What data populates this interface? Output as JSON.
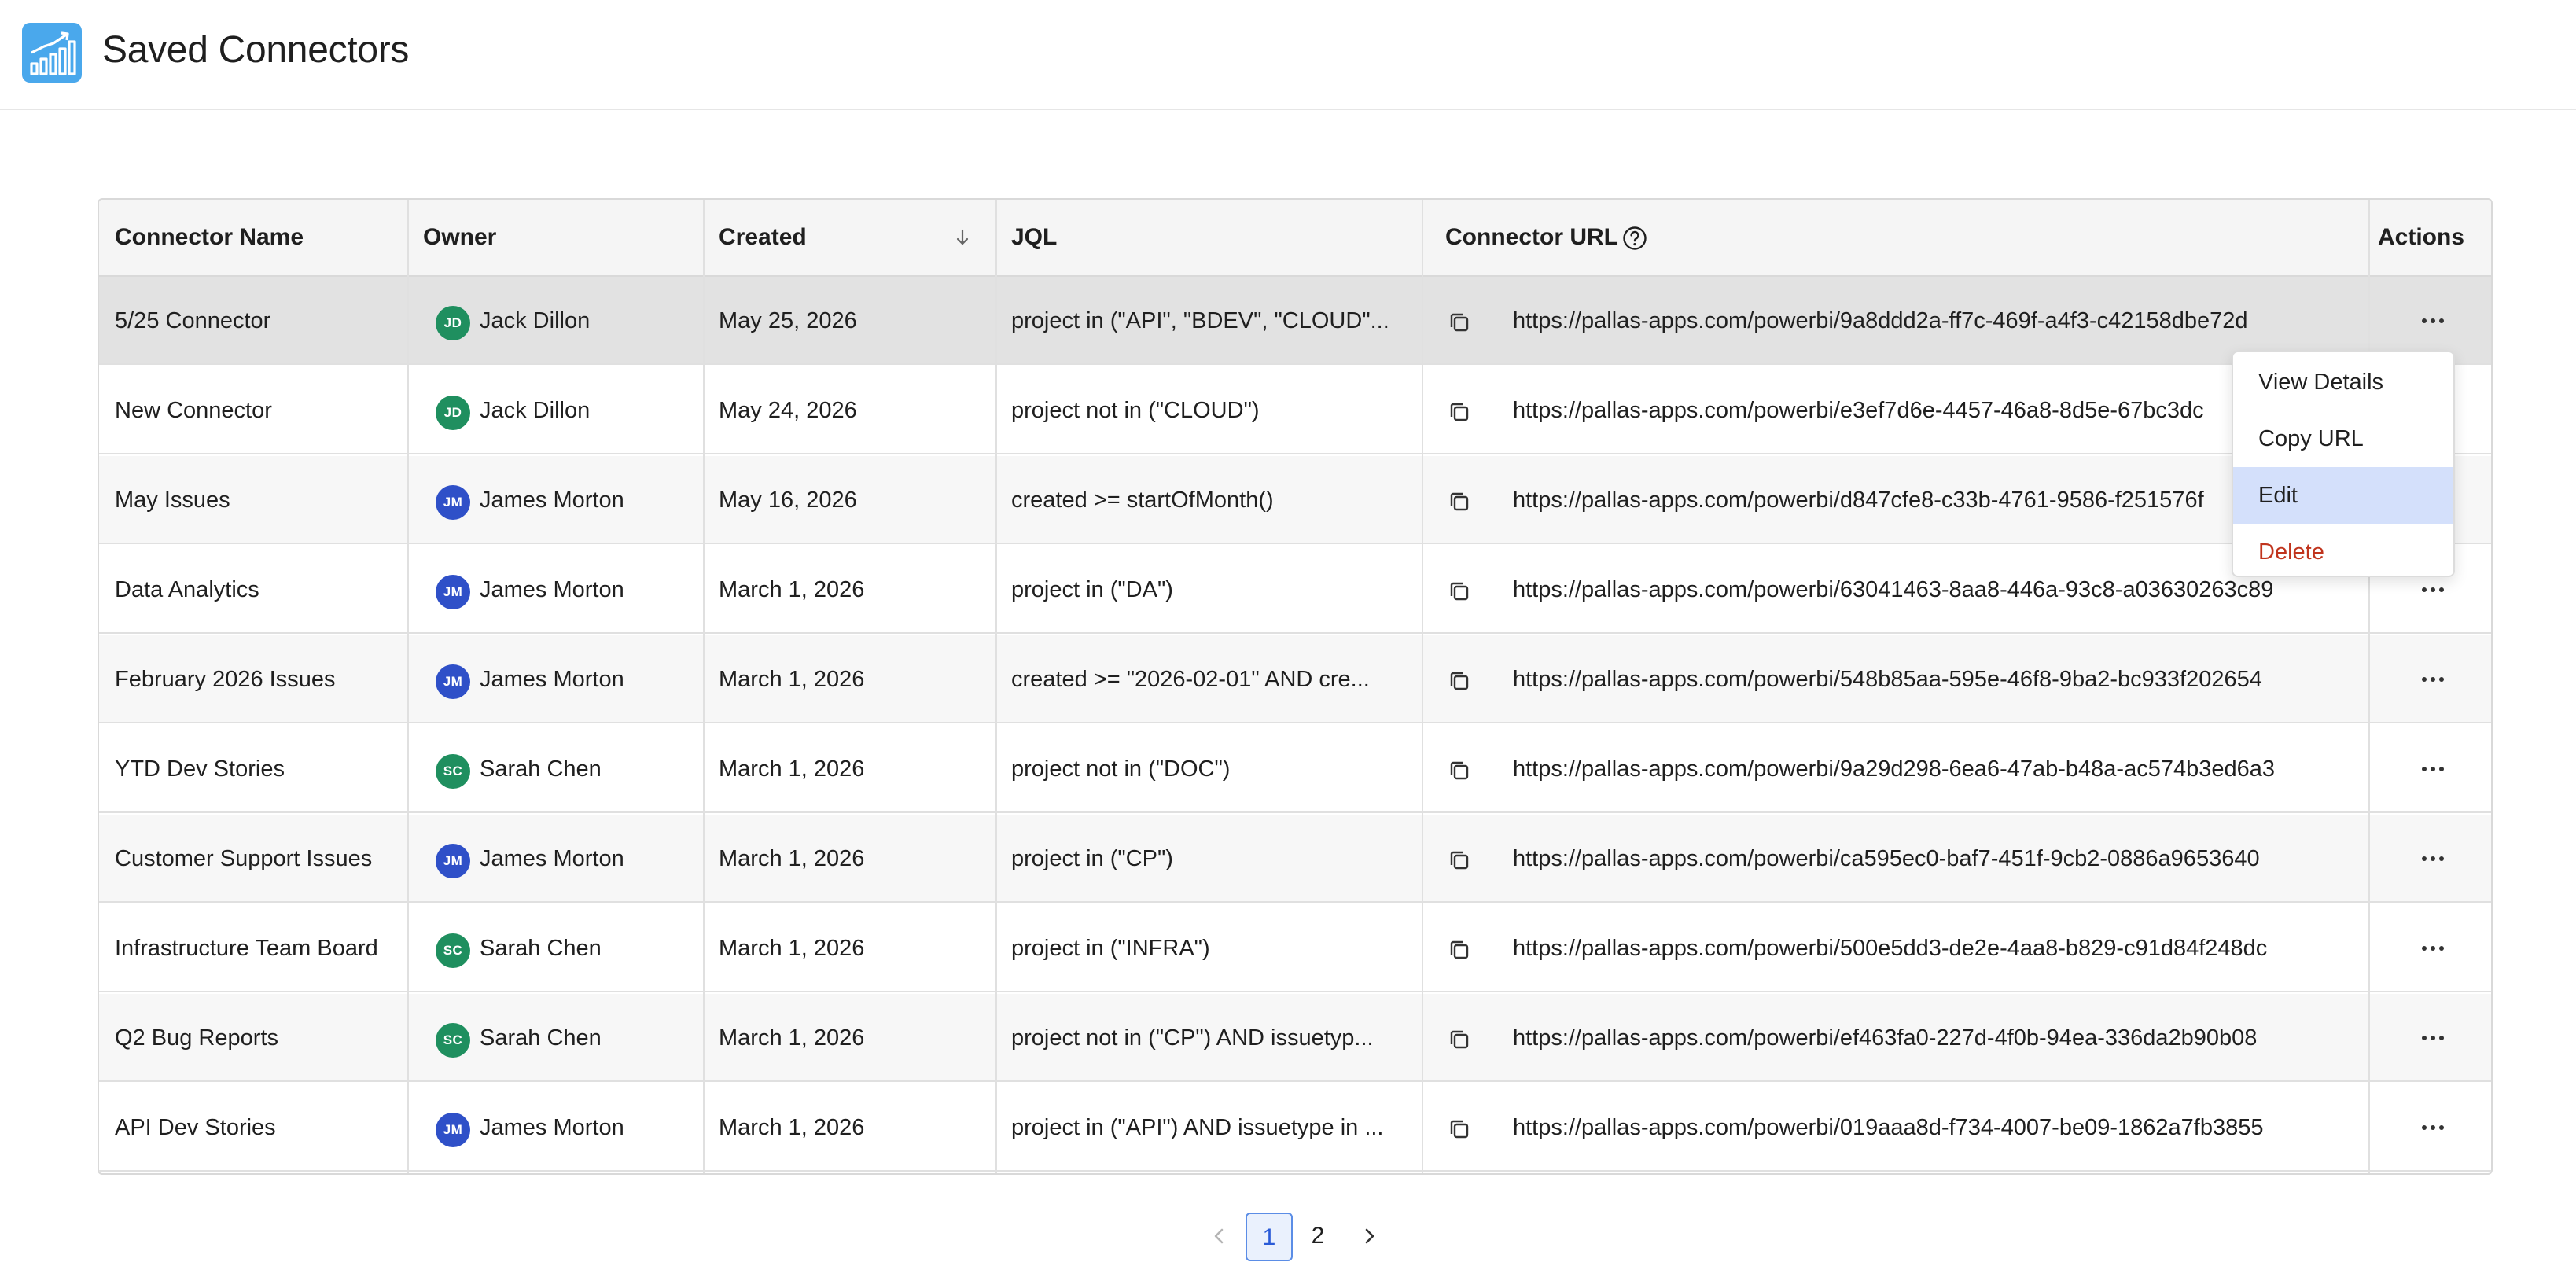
{
  "header": {
    "title": "Saved Connectors",
    "logo_icon": "chart-growth-icon"
  },
  "table": {
    "columns": {
      "name": "Connector Name",
      "owner": "Owner",
      "created": "Created",
      "jql": "JQL",
      "url": "Connector URL",
      "actions": "Actions"
    },
    "sort": {
      "column": "Created",
      "direction": "descending"
    },
    "rows": [
      {
        "name": "5/25 Connector",
        "owner_initials": "JD",
        "owner": "Jack Dillon",
        "owner_color": "#1f8f5f",
        "created": "May 25, 2026",
        "jql": "project in (\"API\", \"BDEV\", \"CLOUD\"...",
        "url": "https://pallas-apps.com/powerbi/9a8ddd2a-ff7c-469f-a4f3-c42158dbe72d"
      },
      {
        "name": "New Connector",
        "owner_initials": "JD",
        "owner": "Jack Dillon",
        "owner_color": "#1f8f5f",
        "created": "May 24, 2026",
        "jql": "project not in (\"CLOUD\")",
        "url": "https://pallas-apps.com/powerbi/e3ef7d6e-4457-46a8-8d5e-67bc3dc"
      },
      {
        "name": "May Issues",
        "owner_initials": "JM",
        "owner": "James Morton",
        "owner_color": "#2f50c8",
        "created": "May 16, 2026",
        "jql": "created >= startOfMonth()",
        "url": "https://pallas-apps.com/powerbi/d847cfe8-c33b-4761-9586-f251576f"
      },
      {
        "name": "Data Analytics",
        "owner_initials": "JM",
        "owner": "James Morton",
        "owner_color": "#2f50c8",
        "created": "March 1, 2026",
        "jql": "project in (\"DA\")",
        "url": "https://pallas-apps.com/powerbi/63041463-8aa8-446a-93c8-a03630263c89"
      },
      {
        "name": "February 2026 Issues",
        "owner_initials": "JM",
        "owner": "James Morton",
        "owner_color": "#2f50c8",
        "created": "March 1, 2026",
        "jql": "created >= \"2026-02-01\" AND cre...",
        "url": "https://pallas-apps.com/powerbi/548b85aa-595e-46f8-9ba2-bc933f202654"
      },
      {
        "name": "YTD Dev Stories",
        "owner_initials": "SC",
        "owner": "Sarah Chen",
        "owner_color": "#1f8f5f",
        "created": "March 1, 2026",
        "jql": "project not in (\"DOC\")",
        "url": "https://pallas-apps.com/powerbi/9a29d298-6ea6-47ab-b48a-ac574b3ed6a3"
      },
      {
        "name": "Customer Support Issues",
        "owner_initials": "JM",
        "owner": "James Morton",
        "owner_color": "#2f50c8",
        "created": "March 1, 2026",
        "jql": "project in (\"CP\")",
        "url": "https://pallas-apps.com/powerbi/ca595ec0-baf7-451f-9cb2-0886a9653640"
      },
      {
        "name": "Infrastructure Team Board",
        "owner_initials": "SC",
        "owner": "Sarah Chen",
        "owner_color": "#1f8f5f",
        "created": "March 1, 2026",
        "jql": "project in (\"INFRA\")",
        "url": "https://pallas-apps.com/powerbi/500e5dd3-de2e-4aa8-b829-c91d84f248dc"
      },
      {
        "name": "Q2 Bug Reports",
        "owner_initials": "SC",
        "owner": "Sarah Chen",
        "owner_color": "#1f8f5f",
        "created": "March 1, 2026",
        "jql": "project not in (\"CP\") AND issuetyp...",
        "url": "https://pallas-apps.com/powerbi/ef463fa0-227d-4f0b-94ea-336da2b90b08"
      },
      {
        "name": "API Dev Stories",
        "owner_initials": "JM",
        "owner": "James Morton",
        "owner_color": "#2f50c8",
        "created": "March 1, 2026",
        "jql": "project in (\"API\") AND issuetype in ...",
        "url": "https://pallas-apps.com/powerbi/019aaa8d-f734-4007-be09-1862a7fb3855"
      }
    ]
  },
  "actions_menu": {
    "items": [
      {
        "label": "View Details",
        "state": "normal"
      },
      {
        "label": "Copy URL",
        "state": "normal"
      },
      {
        "label": "Edit",
        "state": "hover"
      },
      {
        "label": "Delete",
        "state": "danger"
      }
    ]
  },
  "pagination": {
    "pages": [
      "1",
      "2"
    ],
    "current": "1"
  },
  "colors": {
    "accent": "#4aa8ec",
    "danger": "#c0341d",
    "pager_active": "#5b8de6",
    "menu_hover": "#d4e0fb"
  }
}
